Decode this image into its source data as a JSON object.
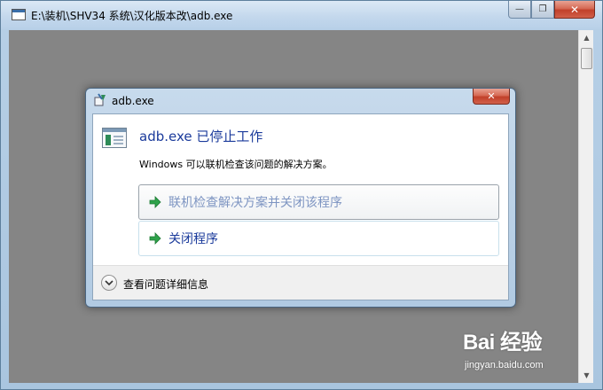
{
  "window": {
    "title": "E:\\装机\\SHV34 系统\\汉化版本改\\adb.exe",
    "minimize_glyph": "—",
    "restore_glyph": "❐",
    "close_glyph": "✕"
  },
  "dialog": {
    "title": "adb.exe",
    "close_glyph": "✕",
    "main_instruction": "adb.exe 已停止工作",
    "content": "Windows 可以联机检查该问题的解决方案。",
    "command_links": [
      {
        "label": "联机检查解决方案并关闭该程序",
        "icon": "green-arrow-icon",
        "state": "disabled"
      },
      {
        "label": "关闭程序",
        "icon": "green-arrow-icon",
        "state": "enabled"
      }
    ],
    "footer": {
      "expand_label": "查看问题详细信息",
      "icon": "chevron-down-icon"
    }
  },
  "watermark": {
    "brand": "Bai 经验",
    "url": "jingyan.baidu.com"
  },
  "colors": {
    "link_text": "#1a3a9b",
    "disabled_link_text": "#7e95c2",
    "console_background": "#858585",
    "arrow_green": "#2ea24a"
  }
}
